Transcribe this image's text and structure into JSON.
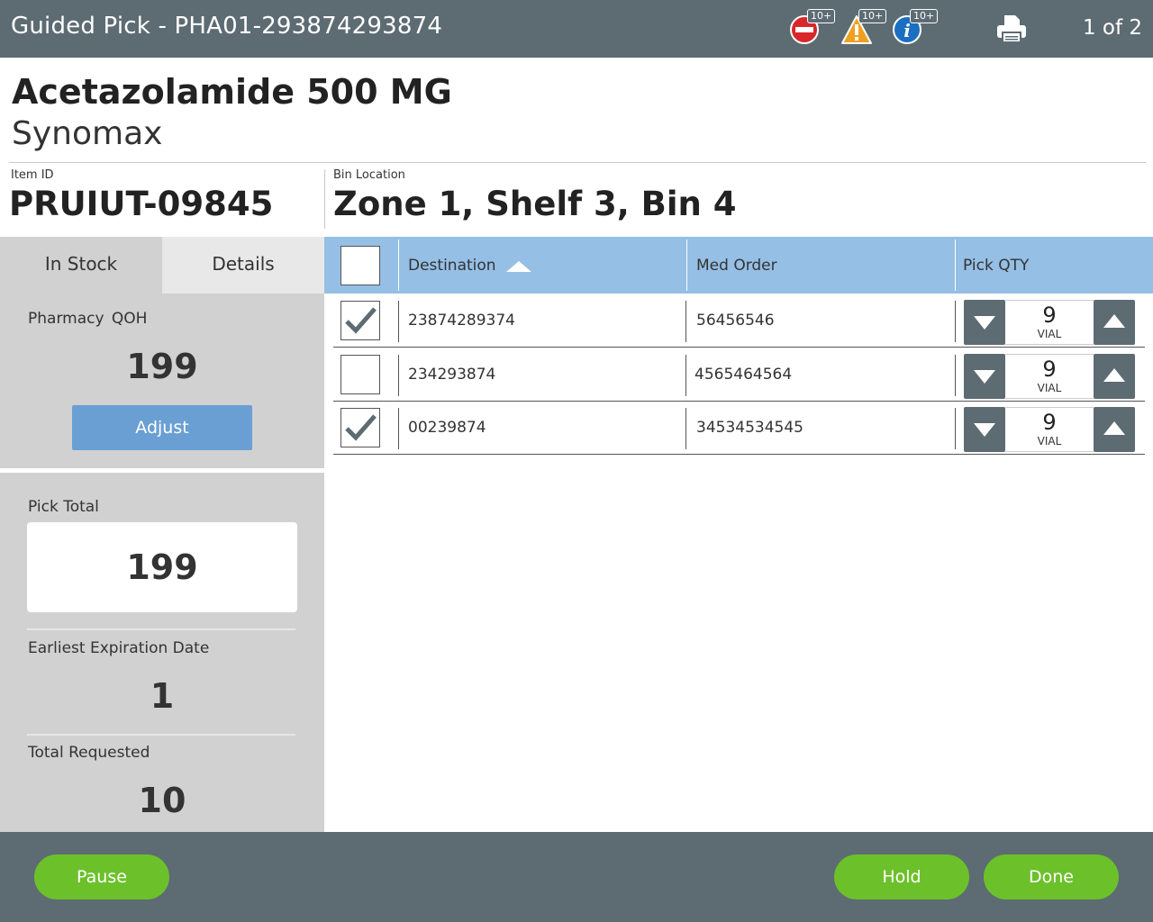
{
  "header": {
    "title": "Guided Pick - PHA01-293874293874",
    "alerts": [
      {
        "icon": "no-entry-icon",
        "badge": "10+",
        "color": "#d9262a"
      },
      {
        "icon": "warning-icon",
        "badge": "10+",
        "color": "#f0a020"
      },
      {
        "icon": "info-icon",
        "badge": "10+",
        "color": "#1a6fc0"
      }
    ],
    "print_icon": "printer-icon",
    "pager": "1 of 2"
  },
  "product": {
    "name": "Acetazolamide 500 MG",
    "manufacturer": "Synomax",
    "item_id_label": "Item ID",
    "item_id": "PRUIUT-09845",
    "bin_label": "Bin Location",
    "bin": "Zone 1, Shelf 3, Bin 4"
  },
  "left_panel": {
    "tabs": [
      {
        "label": "In Stock",
        "active": true
      },
      {
        "label": "Details",
        "active": false
      }
    ],
    "qoh_label": "Pharmacy  QOH",
    "qoh_value": "199",
    "adjust_label": "Adjust",
    "pick_total_label": "Pick Total",
    "pick_total_value": "199",
    "expiration_label": "Earliest Expiration Date",
    "expiration_value": "1",
    "total_requested_label": "Total Requested",
    "total_requested_value": "10"
  },
  "table": {
    "headers": {
      "destination": "Destination",
      "med_order": "Med Order",
      "pick_qty": "Pick QTY"
    },
    "sort": "ascending",
    "rows": [
      {
        "checked": true,
        "destination": "23874289374",
        "med_order": "56456546",
        "qty": "9",
        "unit": "VIAL"
      },
      {
        "checked": false,
        "destination": "234293874",
        "med_order": "4565464564",
        "qty": "9",
        "unit": "VIAL"
      },
      {
        "checked": true,
        "destination": "00239874",
        "med_order": "34534534545",
        "qty": "9",
        "unit": "VIAL"
      }
    ]
  },
  "footer": {
    "pause_label": "Pause",
    "hold_label": "Hold",
    "done_label": "Done",
    "button_color": "#6cc12b"
  },
  "colors": {
    "bar": "#5d6b73",
    "table_header": "#95bfe5",
    "adjust": "#6a9fd4",
    "panel": "#d1d1d1"
  }
}
